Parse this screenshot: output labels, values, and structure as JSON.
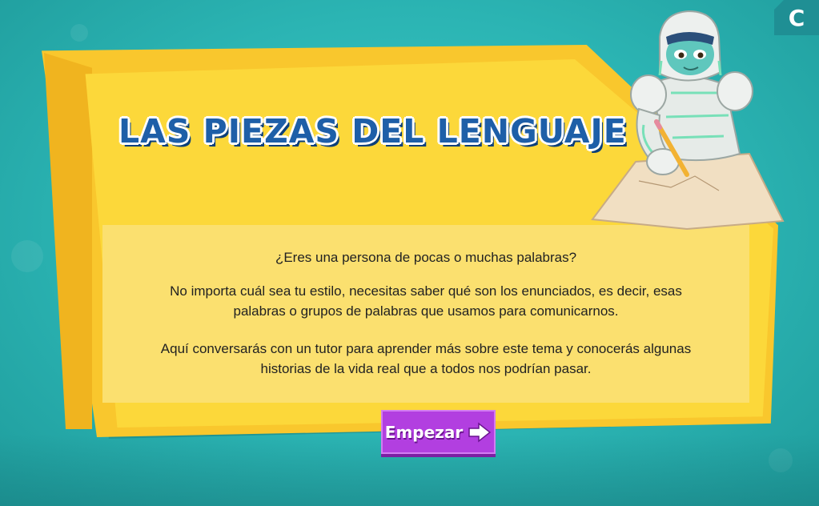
{
  "page": {
    "title": "LAS PIEZAS DEL LENGUAJE",
    "corner_label": "C"
  },
  "intro": {
    "question": "¿Eres una persona de pocas o muchas palabras?",
    "paragraph_1": "No importa cuál sea tu estilo, necesitas saber qué son los enunciados, es decir, esas palabras o grupos de palabras que usamos para comunicarnos.",
    "paragraph_2": "Aquí conversarás con un tutor para aprender más sobre este tema y conocerás algunas historias de la vida real que a todos nos podrían pasar."
  },
  "actions": {
    "start_label": "Empezar"
  },
  "icons": {
    "start_arrow": "arrow-right-icon",
    "character": "robot-writing-illustration"
  },
  "colors": {
    "background": "#2bb4b3",
    "card": "#fcd83a",
    "panel": "#fde68a",
    "title": "#1e5fa8",
    "button": "#b23fe0"
  }
}
